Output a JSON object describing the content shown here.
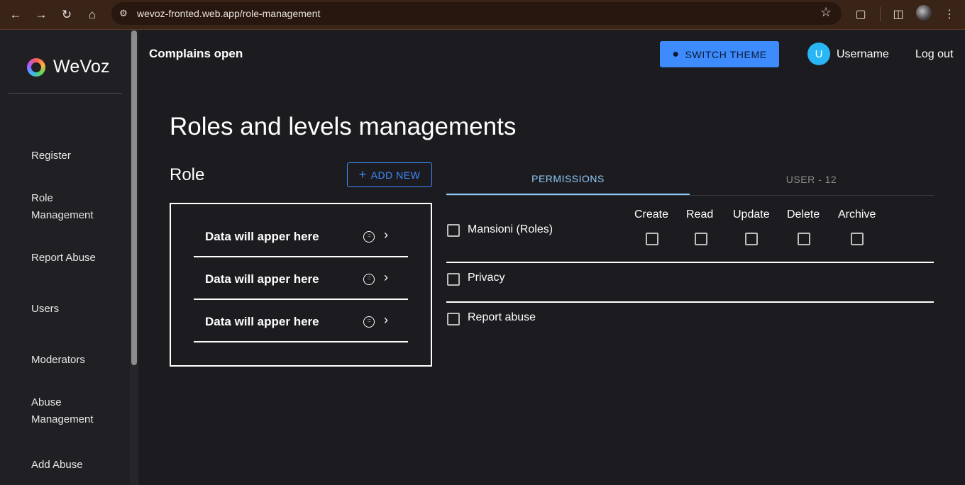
{
  "browser": {
    "url": "wevoz-fronted.web.app/role-management"
  },
  "sidebar": {
    "logo_text": "WeVoz",
    "items": [
      {
        "label": "Register"
      },
      {
        "label": "Role Management"
      },
      {
        "label": "Report Abuse"
      },
      {
        "label": "Users"
      },
      {
        "label": "Moderators"
      },
      {
        "label": "Abuse Management"
      },
      {
        "label": "Add Abuse"
      }
    ]
  },
  "topbar": {
    "title": "Complains open",
    "theme_button": "SWITCH THEME",
    "avatar_initial": "U",
    "username": "Username",
    "logout": "Log out"
  },
  "main": {
    "page_title": "Roles and levels managements",
    "role_heading": "Role",
    "add_new": "ADD NEW",
    "roles": [
      {
        "label": "Data will apper here"
      },
      {
        "label": "Data will apper here"
      },
      {
        "label": "Data will apper here"
      }
    ],
    "tabs": [
      {
        "label": "PERMISSIONS",
        "active": true
      },
      {
        "label": "USER - 12",
        "active": false
      }
    ],
    "permission_columns": [
      "Create",
      "Read",
      "Update",
      "Delete",
      "Archive"
    ],
    "permissions": [
      {
        "label": "Mansioni (Roles)"
      },
      {
        "label": "Privacy"
      },
      {
        "label": "Report abuse"
      }
    ]
  },
  "colors": {
    "accent": "#3d8bfd",
    "tab_active": "#90caf9",
    "avatar": "#29b6f6",
    "background": "#1c1b1f"
  }
}
